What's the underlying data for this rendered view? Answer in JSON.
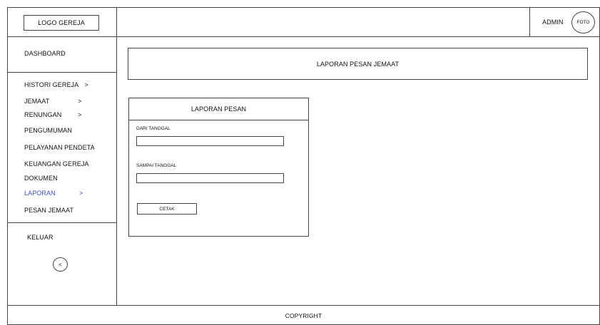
{
  "header": {
    "logo_label": "LOGO GEREJA",
    "user_name": "ADMIN",
    "avatar_label": "FOTO"
  },
  "sidebar": {
    "dashboard": "DASHBOARD",
    "items": [
      {
        "label": "HISTORI GEREJA",
        "chevron": ">"
      },
      {
        "label": "JEMAAT",
        "chevron": ">"
      },
      {
        "label": "RENUNGAN",
        "chevron": ">"
      },
      {
        "label": "PENGUMUMAN"
      },
      {
        "label": "PELAYANAN PENDETA"
      },
      {
        "label": "KEUANGAN GEREJA"
      },
      {
        "label": "DOKUMEN"
      },
      {
        "label": "LAPORAN",
        "chevron": ">",
        "active": true
      },
      {
        "label": "PESAN JEMAAT"
      }
    ],
    "logout": "KELUAR",
    "collapse_glyph": "<"
  },
  "main": {
    "page_title": "LAPORAN PESAN JEMAAT",
    "card": {
      "title": "LAPORAN PESAN",
      "from_label": "DARI TANGGAL",
      "from_value": "",
      "to_label": "SAMPAI TANGGAL",
      "to_value": "",
      "print_button": "CETAK"
    }
  },
  "footer": {
    "copyright": "COPYRIGHT"
  },
  "colors": {
    "active_menu": "#3a4fd6",
    "border": "#444444"
  }
}
